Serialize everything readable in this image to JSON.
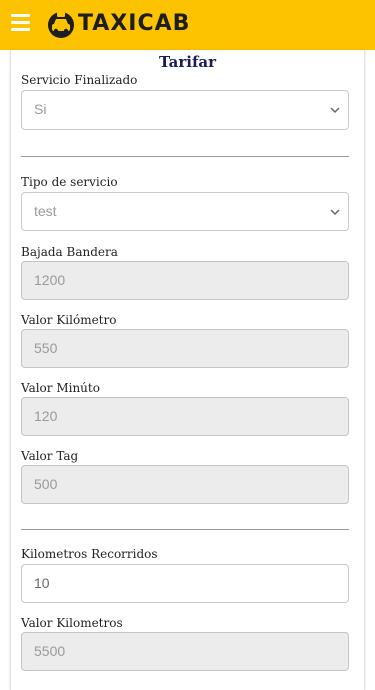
{
  "app": {
    "logo_text": "TAXICAB"
  },
  "page": {
    "title": "Tarifar"
  },
  "form": {
    "servicio_finalizado": {
      "label": "Servicio Finalizado",
      "value": "Si"
    },
    "tipo_servicio": {
      "label": "Tipo de servicio",
      "value": "test"
    },
    "bajada_bandera": {
      "label": "Bajada Bandera",
      "value": "1200"
    },
    "valor_kilometro": {
      "label": "Valor Kilómetro",
      "value": "550"
    },
    "valor_minuto": {
      "label": "Valor Minúto",
      "value": "120"
    },
    "valor_tag": {
      "label": "Valor Tag",
      "value": "500"
    },
    "kilometros_recorridos": {
      "label": "Kilometros Recorridos",
      "value": "10"
    },
    "valor_kilometros": {
      "label": "Valor Kilometros",
      "value": "5500"
    }
  },
  "colors": {
    "header": "#fec300",
    "title": "#1a1a5e"
  },
  "icons": {
    "menu": "hamburger-icon",
    "logo": "taxi-icon",
    "select": "chevron-down-icon"
  }
}
